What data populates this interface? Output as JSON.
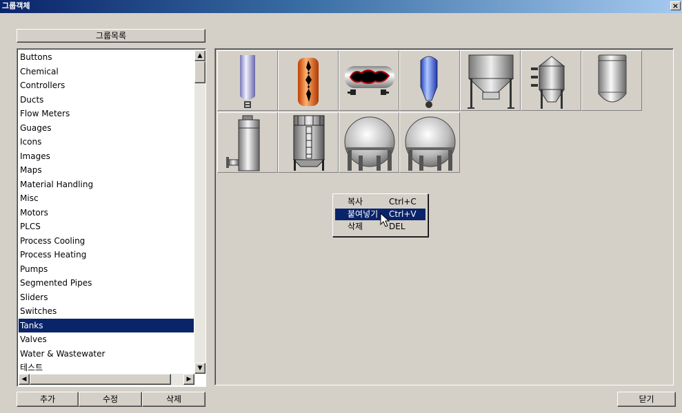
{
  "window": {
    "title": "그룹객체",
    "close_label": "×"
  },
  "groups_panel": {
    "header": "그룹목록",
    "items": [
      "Buttons",
      "Chemical",
      "Controllers",
      "Ducts",
      "Flow Meters",
      "Guages",
      "Icons",
      "Images",
      "Maps",
      "Material Handling",
      "Misc",
      "Motors",
      "PLCS",
      "Process Cooling",
      "Process Heating",
      "Pumps",
      "Segmented Pipes",
      "Sliders",
      "Switches",
      "Tanks",
      "Valves",
      "Water & Wastewater",
      "테스트"
    ],
    "selected": "Tanks",
    "buttons": {
      "add": "추가",
      "edit": "수정",
      "delete": "삭제"
    }
  },
  "objects": [
    {
      "icon": "vertical-tank-icon"
    },
    {
      "icon": "orange-heated-tank-icon"
    },
    {
      "icon": "horizontal-tank-icon"
    },
    {
      "icon": "blue-cone-tank-icon"
    },
    {
      "icon": "hopper-tank-icon"
    },
    {
      "icon": "silo-tank-icon"
    },
    {
      "icon": "capsule-tank-icon"
    },
    {
      "icon": "cylinder-column-icon"
    },
    {
      "icon": "caged-silo-icon"
    },
    {
      "icon": "sphere-tank-icon"
    },
    {
      "icon": "sphere-tank-icon"
    }
  ],
  "context_menu": {
    "items": [
      {
        "label": "복사",
        "shortcut": "Ctrl+C"
      },
      {
        "label": "붙여넣기",
        "shortcut": "Ctrl+V"
      },
      {
        "label": "삭제",
        "shortcut": "DEL"
      }
    ],
    "highlighted": "붙여넣기"
  },
  "footer": {
    "close_button": "닫기"
  },
  "colors": {
    "selection": "#0a246a",
    "face": "#d4d0c8",
    "title_start": "#0a246a",
    "title_end": "#a6caf0"
  }
}
